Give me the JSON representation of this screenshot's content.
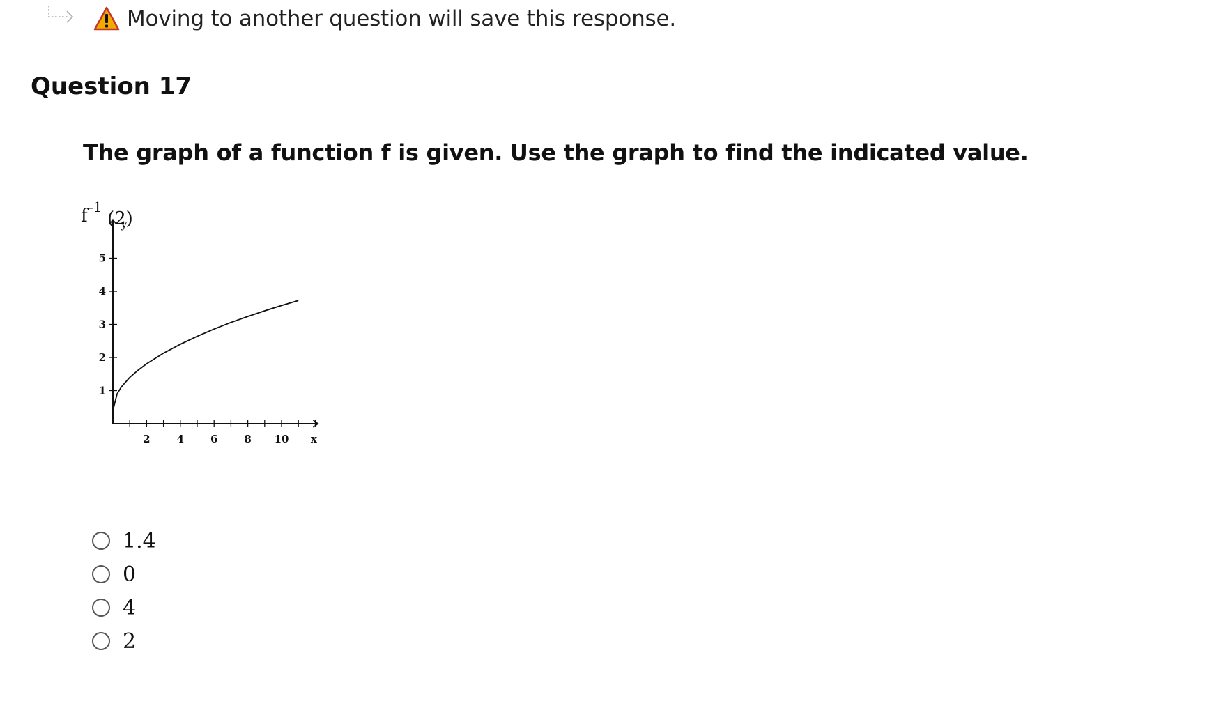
{
  "notice": {
    "text": "Moving to another question will save this response.",
    "icon": "warning-triangle-icon",
    "icon_color": "#f2a900"
  },
  "question": {
    "title": "Question 17",
    "prompt": "The graph of a function f is given. Use the graph to find the indicated value.",
    "expression": {
      "base": "f",
      "superscript": "-1",
      "argument": "(2)"
    }
  },
  "chart_data": {
    "type": "line",
    "title": "",
    "xlabel": "x",
    "ylabel": "y",
    "xlim": [
      0,
      12
    ],
    "ylim": [
      0,
      6
    ],
    "x_ticks": [
      2,
      4,
      6,
      8,
      10
    ],
    "y_ticks": [
      1,
      2,
      3,
      4,
      5
    ],
    "grid": false,
    "series": [
      {
        "x": [
          0,
          0.25,
          0.5,
          1,
          1.5,
          2,
          3,
          4,
          5,
          6,
          7,
          8,
          9,
          10,
          11
        ],
        "y": [
          0.4,
          0.9,
          1.11,
          1.4,
          1.62,
          1.81,
          2.13,
          2.4,
          2.64,
          2.86,
          3.06,
          3.24,
          3.41,
          3.57,
          3.72
        ]
      }
    ]
  },
  "choices": [
    {
      "label": "1.4"
    },
    {
      "label": "0"
    },
    {
      "label": "4"
    },
    {
      "label": "2"
    }
  ]
}
